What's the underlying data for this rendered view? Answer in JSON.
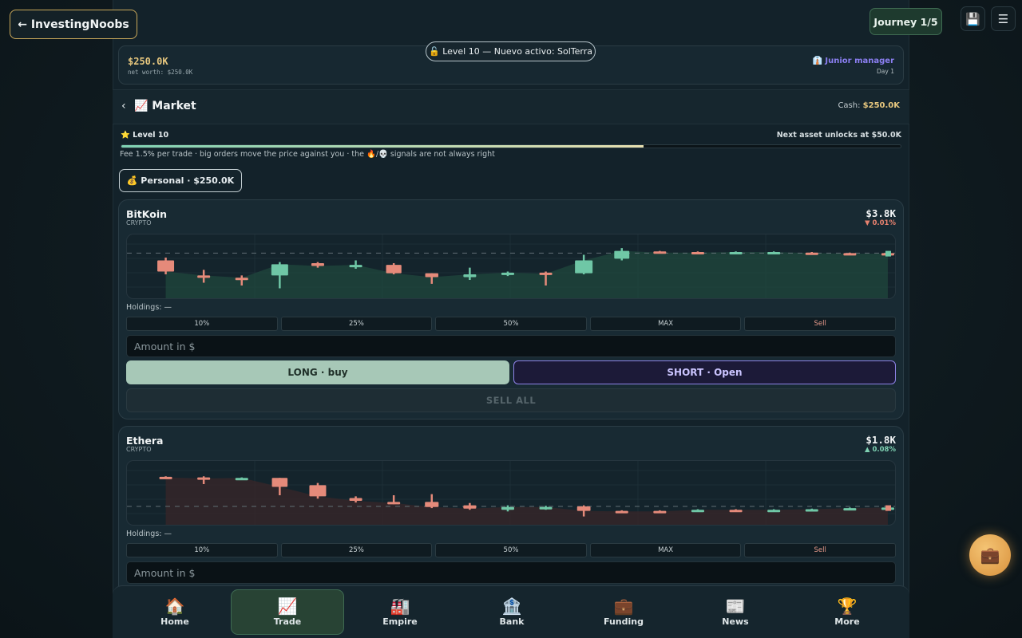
{
  "header": {
    "back_label": "← InvestingNoobs",
    "journey_label": "Journey 1/5",
    "save_icon": "💾",
    "menu_icon": "☰"
  },
  "wallet": {
    "cash": "$250.0K",
    "net_worth": "net worth: $250.0K",
    "role": "👔 Junior manager",
    "day": "Day 1"
  },
  "unlock_banner": "🔓 Level 10 — Nuevo activo: SolTerra",
  "market": {
    "back_icon": "‹",
    "title": "📈 Market",
    "cash_label": "Cash:",
    "cash_value": "$250.0K",
    "level": "⭐ Level 10",
    "next_unlock": "Next asset unlocks at $50.0K",
    "progress": 0.67,
    "fee_note": "Fee 1.5% per trade · big orders move the price against you · the 🔥/💀 signals are not always right",
    "account": "💰 Personal · $250.0K"
  },
  "assets": [
    {
      "name": "BitKoin",
      "type": "CRYPTO",
      "price": "$3.8K",
      "change": "▼ 0.01%",
      "change_color": "#e8826f",
      "holdings": "Holdings: —",
      "amount_placeholder": "Amount in $",
      "candles": [
        [
          0.35,
          0.55,
          0.3,
          0.6
        ],
        [
          0.62,
          0.62,
          0.52,
          0.75
        ],
        [
          0.66,
          0.66,
          0.62,
          0.8
        ],
        [
          0.62,
          0.42,
          0.38,
          0.85
        ],
        [
          0.4,
          0.45,
          0.38,
          0.48
        ],
        [
          0.45,
          0.43,
          0.35,
          0.5
        ],
        [
          0.43,
          0.58,
          0.4,
          0.6
        ],
        [
          0.58,
          0.65,
          0.58,
          0.77
        ],
        [
          0.65,
          0.6,
          0.48,
          0.7
        ],
        [
          0.6,
          0.57,
          0.55,
          0.63
        ],
        [
          0.57,
          0.59,
          0.55,
          0.8
        ],
        [
          0.58,
          0.35,
          0.25,
          0.6
        ],
        [
          0.32,
          0.18,
          0.13,
          0.35
        ],
        [
          0.19,
          0.21,
          0.18,
          0.22
        ],
        [
          0.2,
          0.21,
          0.19,
          0.22
        ],
        [
          0.21,
          0.2,
          0.19,
          0.22
        ],
        [
          0.21,
          0.2,
          0.19,
          0.22
        ],
        [
          0.21,
          0.22,
          0.2,
          0.23
        ],
        [
          0.22,
          0.23,
          0.21,
          0.24
        ],
        [
          0.22,
          0.23,
          0.21,
          0.24
        ]
      ],
      "last_bar": [
        0.18,
        0.28
      ],
      "baseline": 0.22,
      "area_color": "#1f4a3d",
      "buttons": [
        "10%",
        "25%",
        "50%",
        "MAX",
        "Sell"
      ],
      "long_label": "LONG · buy",
      "short_label": "SHORT · Open",
      "sell_all_label": "SELL ALL"
    },
    {
      "name": "Ethera",
      "type": "CRYPTO",
      "price": "$1.8K",
      "change": "▲ 0.08%",
      "change_color": "#7fd2b3",
      "holdings": "Holdings: —",
      "amount_placeholder": "Amount in $",
      "candles": [
        [
          0.17,
          0.18,
          0.16,
          0.19
        ],
        [
          0.18,
          0.2,
          0.16,
          0.3
        ],
        [
          0.2,
          0.19,
          0.18,
          0.21
        ],
        [
          0.19,
          0.35,
          0.19,
          0.5
        ],
        [
          0.32,
          0.52,
          0.28,
          0.56
        ],
        [
          0.55,
          0.6,
          0.52,
          0.63
        ],
        [
          0.62,
          0.64,
          0.5,
          0.66
        ],
        [
          0.62,
          0.71,
          0.48,
          0.73
        ],
        [
          0.68,
          0.74,
          0.64,
          0.76
        ],
        [
          0.76,
          0.71,
          0.68,
          0.79
        ],
        [
          0.74,
          0.71,
          0.69,
          0.76
        ],
        [
          0.7,
          0.78,
          0.68,
          0.88
        ],
        [
          0.78,
          0.79,
          0.77,
          0.8
        ],
        [
          0.78,
          0.79,
          0.77,
          0.8
        ],
        [
          0.78,
          0.76,
          0.75,
          0.79
        ],
        [
          0.76,
          0.76,
          0.75,
          0.77
        ],
        [
          0.77,
          0.76,
          0.75,
          0.77
        ],
        [
          0.76,
          0.75,
          0.74,
          0.76
        ],
        [
          0.76,
          0.73,
          0.72,
          0.76
        ],
        [
          0.73,
          0.72,
          0.71,
          0.74
        ]
      ],
      "last_bar": [
        0.68,
        0.78
      ],
      "baseline": 0.7,
      "area_color": "#3a2628",
      "buttons": [
        "10%",
        "25%",
        "50%",
        "MAX",
        "Sell"
      ],
      "long_label": "LONG · buy",
      "short_label": "SHORT · Open",
      "sell_all_label": "SELL ALL"
    }
  ],
  "colors": {
    "up": "#6fc7a6",
    "down": "#e58a7a",
    "accent_gold": "#e7c77e",
    "accent_purple": "#8e83e8"
  },
  "nav": [
    {
      "icon": "🏠",
      "label": "Home",
      "active": false
    },
    {
      "icon": "📈",
      "label": "Trade",
      "active": true
    },
    {
      "icon": "🏭",
      "label": "Empire",
      "active": false
    },
    {
      "icon": "🏦",
      "label": "Bank",
      "active": false
    },
    {
      "icon": "💼",
      "label": "Funding",
      "active": false
    },
    {
      "icon": "📰",
      "label": "News",
      "active": false
    },
    {
      "icon": "🏆",
      "label": "More",
      "active": false
    }
  ],
  "fab_icon": "💼"
}
